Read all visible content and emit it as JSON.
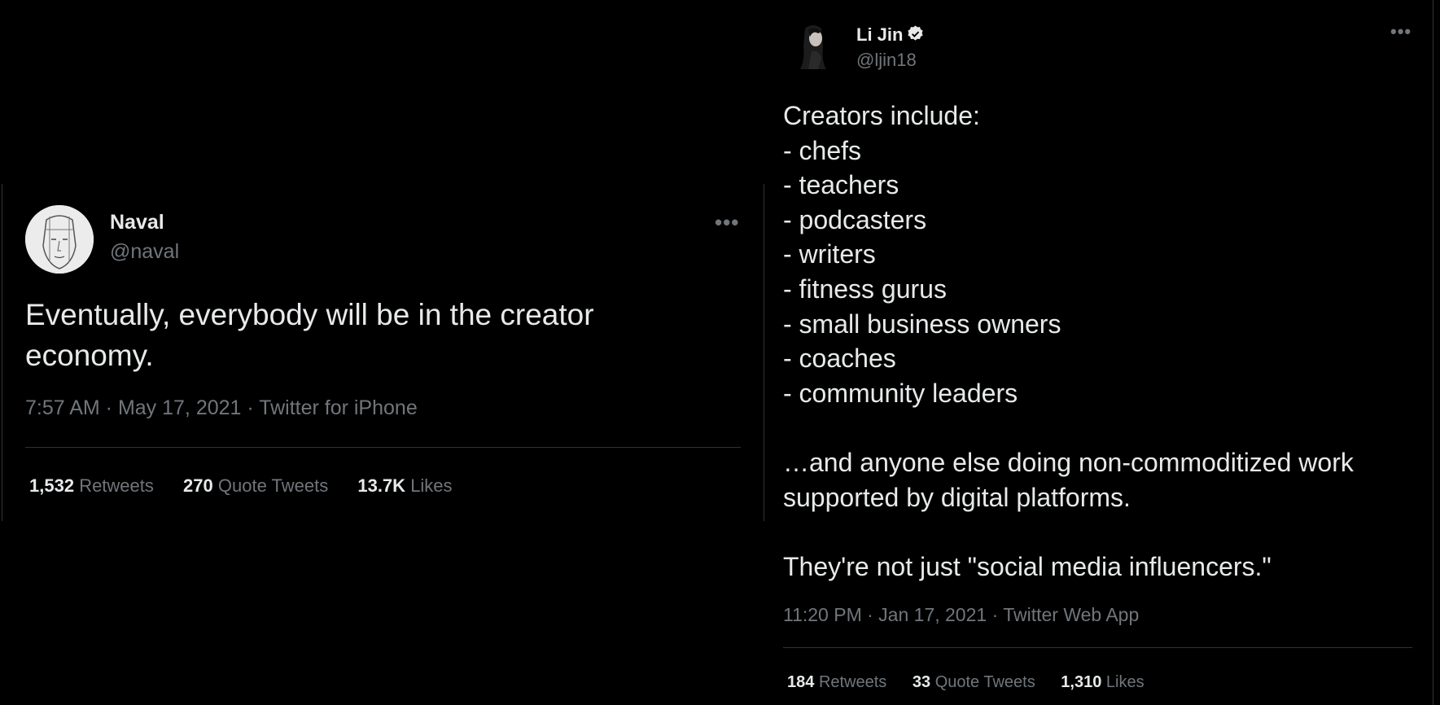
{
  "tweets": [
    {
      "author": {
        "name": "Naval",
        "handle": "@naval",
        "verified": false,
        "avatar_icon": "sketch-face-avatar"
      },
      "text": "Eventually, everybody will be in the creator\neconomy.",
      "meta": "7:57 AM · May 17, 2021 · Twitter for iPhone",
      "more_label": "•••",
      "stats": {
        "retweets": {
          "count": "1,532",
          "label": "Retweets"
        },
        "quotes": {
          "count": "270",
          "label": "Quote Tweets"
        },
        "likes": {
          "count": "13.7K",
          "label": "Likes"
        }
      }
    },
    {
      "author": {
        "name": "Li Jin",
        "handle": "@ljin18",
        "verified": true,
        "avatar_icon": "profile-photo-avatar"
      },
      "text": "Creators include:\n- chefs\n- teachers\n- podcasters\n- writers\n- fitness gurus\n- small business owners\n- coaches\n- community leaders\n\n…and anyone else doing non-commoditized work\nsupported by digital platforms.\n\nThey're not just \"social media influencers.\"",
      "meta": "11:20 PM · Jan 17, 2021 · Twitter Web App",
      "more_label": "•••",
      "stats": {
        "retweets": {
          "count": "184",
          "label": "Retweets"
        },
        "quotes": {
          "count": "33",
          "label": "Quote Tweets"
        },
        "likes": {
          "count": "1,310",
          "label": "Likes"
        }
      }
    }
  ],
  "colors": {
    "background": "#000000",
    "text": "#e7e9ea",
    "muted": "#71767b",
    "divider": "#2f3336"
  }
}
